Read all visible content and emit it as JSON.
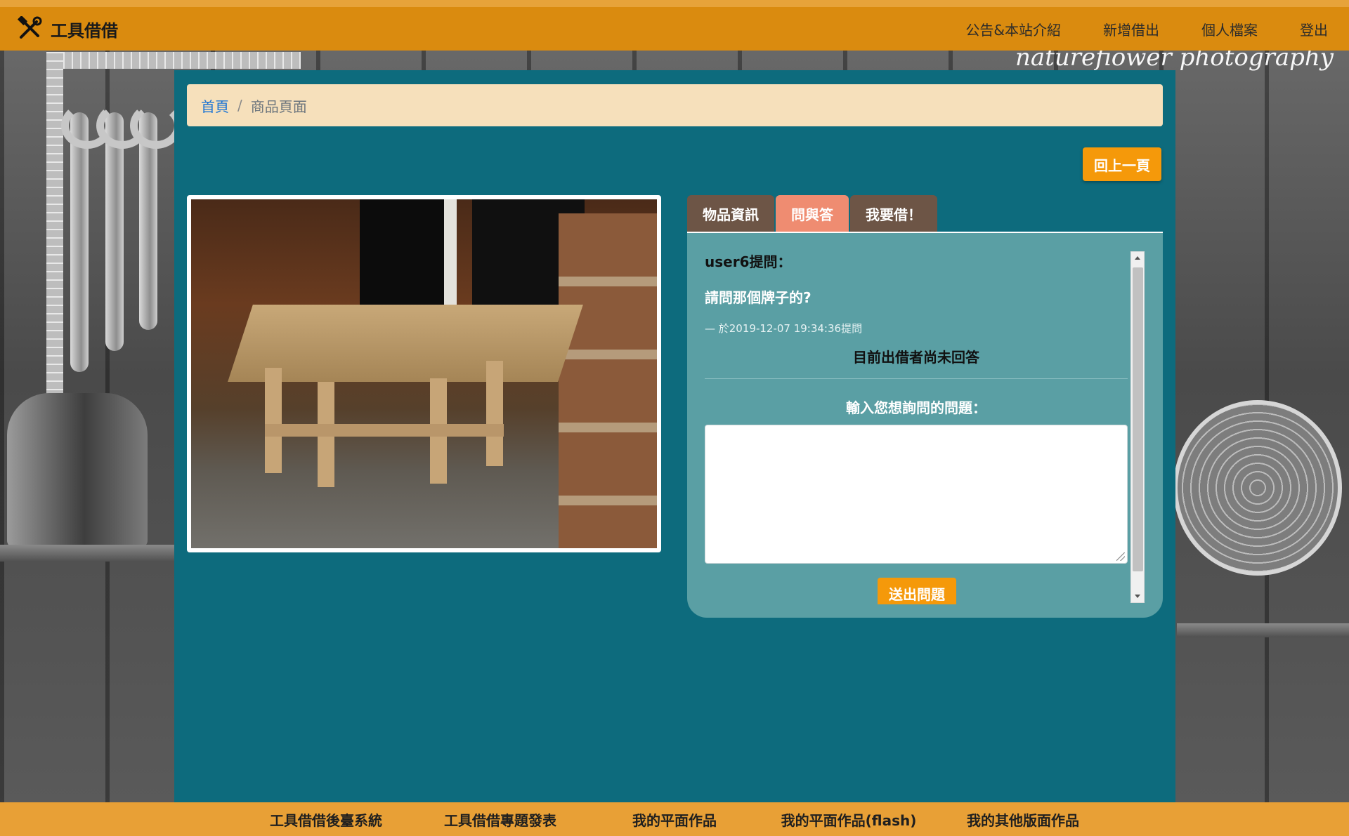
{
  "brand": {
    "name": "工具借借",
    "icon": "tools-icon"
  },
  "nav": {
    "items": [
      {
        "label": "公告&本站介紹"
      },
      {
        "label": "新增借出"
      },
      {
        "label": "個人檔案"
      },
      {
        "label": "登出"
      }
    ]
  },
  "background": {
    "watermark": "naturefiower photography"
  },
  "breadcrumb": {
    "home": "首頁",
    "separator": "/",
    "current": "商品頁面"
  },
  "back_button": {
    "label": "回上一頁"
  },
  "tabs": [
    {
      "label": "物品資訊",
      "active": false
    },
    {
      "label": "問與答",
      "active": true
    },
    {
      "label": "我要借！",
      "active": false
    }
  ],
  "qa": {
    "asker": "user6提問：",
    "question": "請問那個牌子的?",
    "time": "— 於2019-12-07 19:34:36提問",
    "answer_status": "目前出借者尚未回答",
    "ask_label": "輸入您想詢問的問題：",
    "ask_input_value": "",
    "submit_label": "送出問題"
  },
  "footer": {
    "links": [
      {
        "label": "工具借借後臺系統"
      },
      {
        "label": "工具借借專題發表"
      },
      {
        "label": "我的平面作品"
      },
      {
        "label": "我的平面作品(flash)"
      },
      {
        "label": "我的其他版面作品"
      }
    ]
  },
  "colors": {
    "navbar": "#da8b0f",
    "main_panel": "#0d6b7d",
    "breadcrumb_bg": "#f6e0bb",
    "accent_button": "#f5990a",
    "active_tab": "#ef8c71",
    "inactive_tab": "#6d5546",
    "tab_panel": "#5a9fa4"
  }
}
